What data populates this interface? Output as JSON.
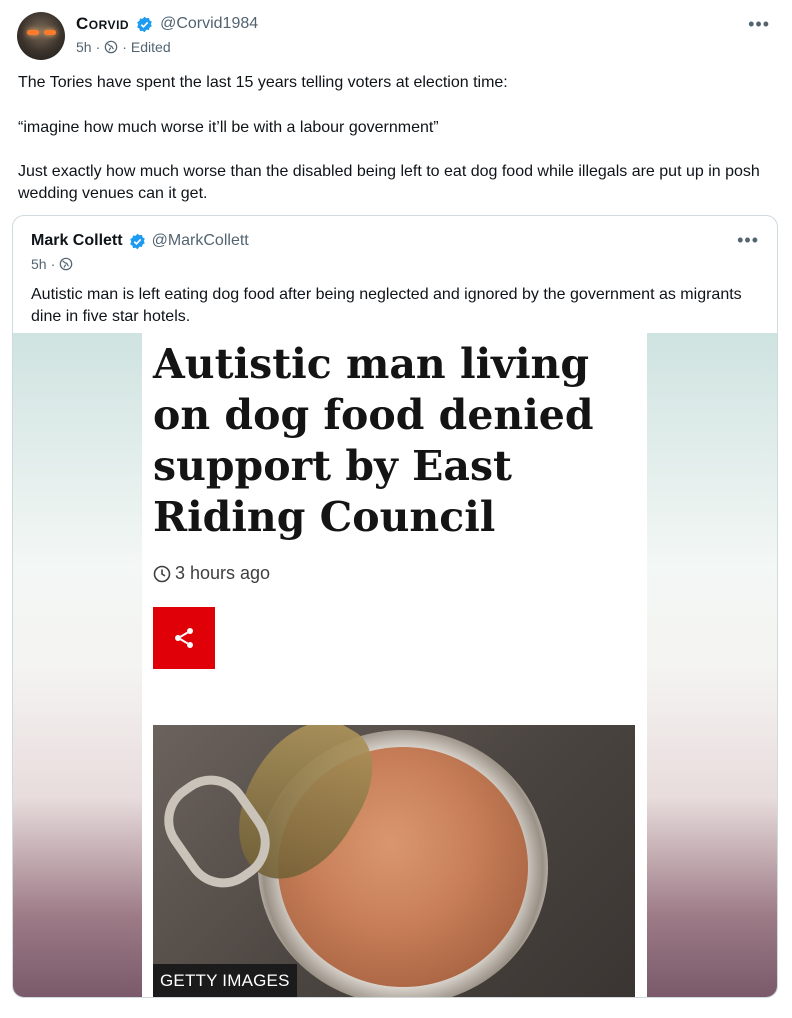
{
  "post": {
    "author_name": "Corvid",
    "handle": "@Corvid1984",
    "time": "5h",
    "dot": "·",
    "edited": "Edited",
    "more": "•••",
    "text_line1": "The Tories have spent the last 15 years telling voters at election time:",
    "text_line2": "“imagine how much worse it’ll be with a labour government”",
    "text_line3": "Just exactly how much worse than the disabled being left to eat dog food while illegals are put up in posh wedding venues can it get."
  },
  "quote": {
    "author_name": "Mark Collett",
    "handle": "@MarkCollett",
    "time": "5h",
    "dot": "·",
    "more": "•••",
    "text": "Autistic man is left eating dog food after being neglected and ignored by the government as migrants dine in five star hotels.",
    "article": {
      "headline": "Autistic man living on dog food denied support by East Riding Council",
      "time_ago": "3 hours ago",
      "photo_credit": "GETTY IMAGES"
    }
  },
  "colors": {
    "verified": "#1d9bf0",
    "share": "#e00008",
    "muted": "#536471"
  },
  "icons": [
    "verified-icon",
    "globe-icon",
    "clock-icon",
    "share-icon",
    "more-icon"
  ]
}
